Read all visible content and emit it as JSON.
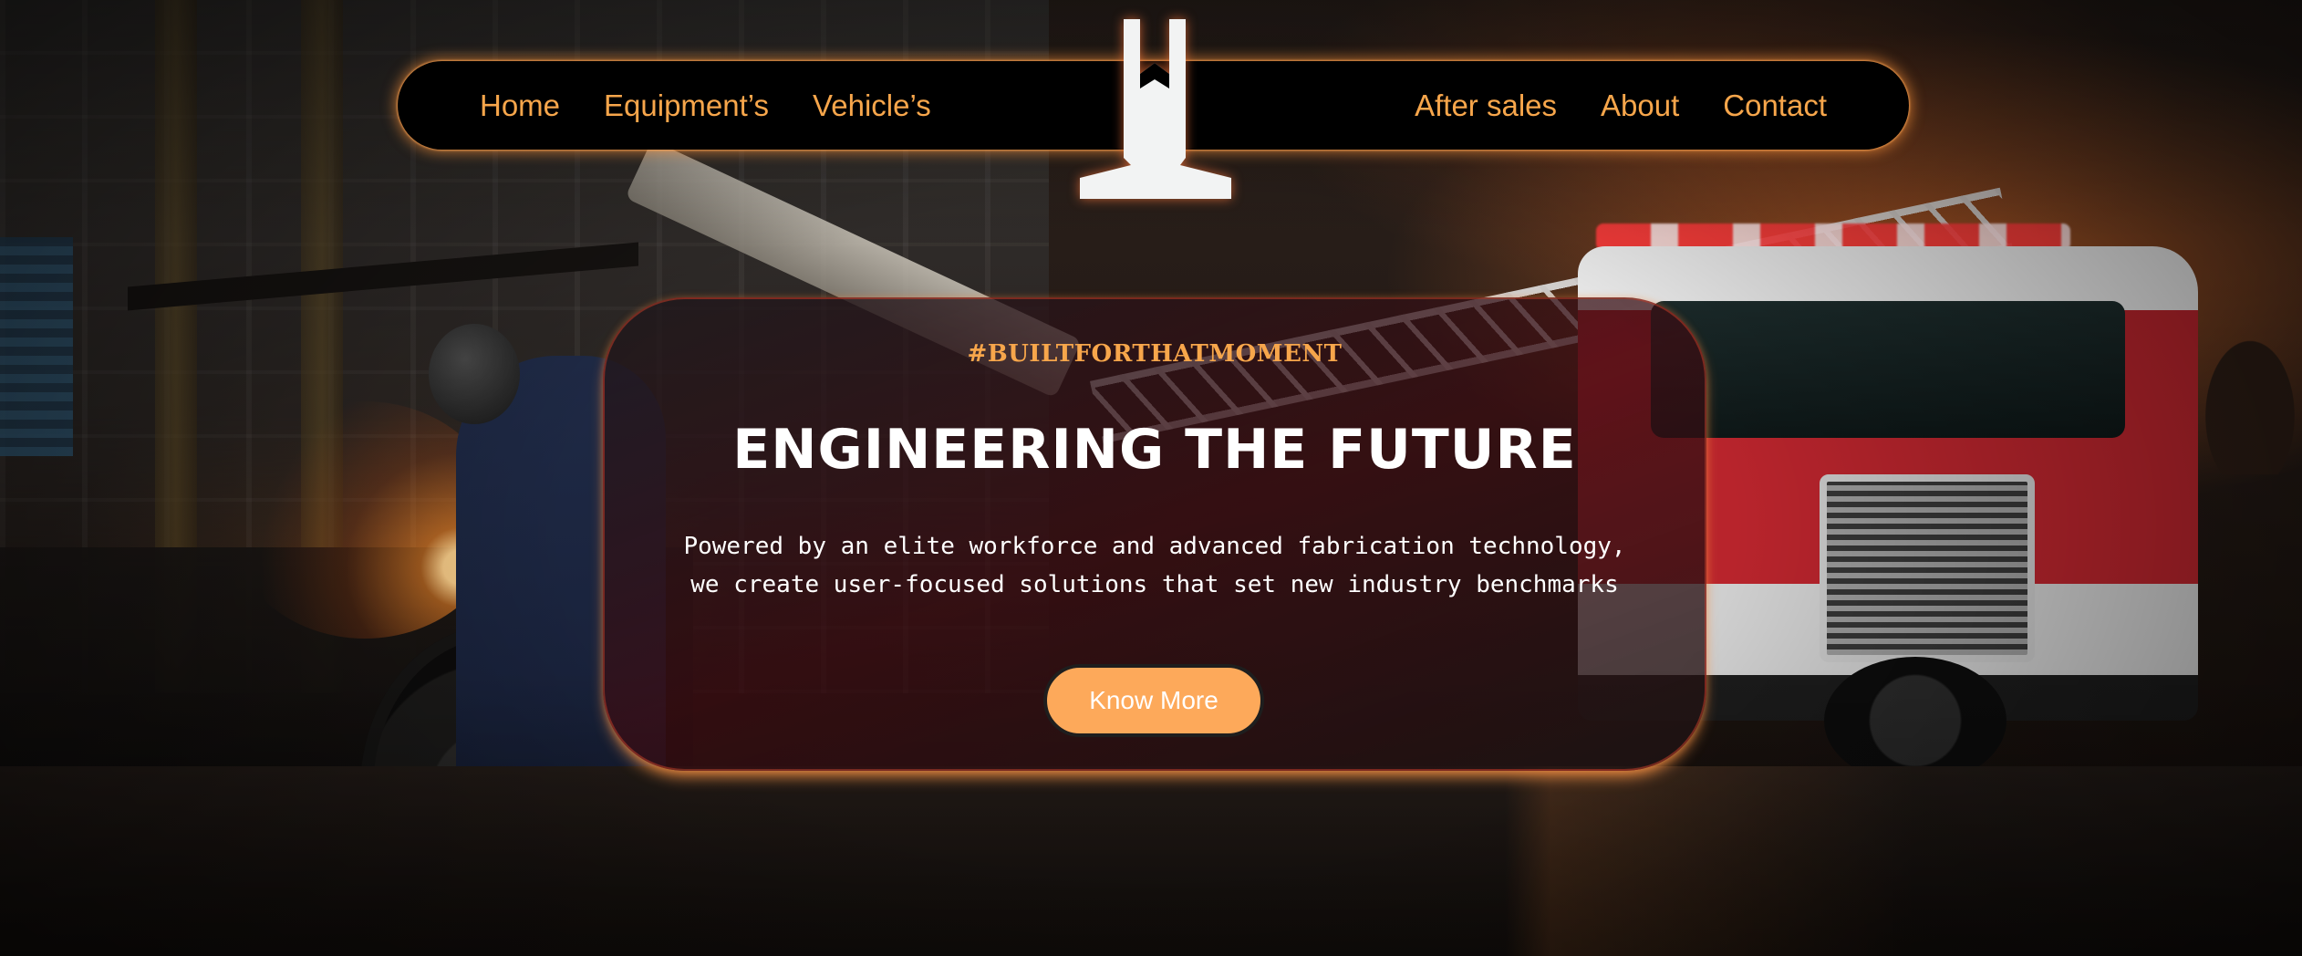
{
  "nav": {
    "left_items": [
      {
        "label": "Home"
      },
      {
        "label": "Equipment’s"
      },
      {
        "label": "Vehicle’s"
      }
    ],
    "right_items": [
      {
        "label": "After sales"
      },
      {
        "label": "About"
      },
      {
        "label": "Contact"
      }
    ]
  },
  "logo": {
    "icon": "brand-logo-icon"
  },
  "hero": {
    "hashtag": "#BUILTFORTHATMOMENT",
    "title": "ENGINEERING THE FUTURE",
    "description_lines": [
      "Powered by an elite workforce and advanced fabrication technology,",
      "we create user-focused solutions that set new industry benchmarks"
    ],
    "cta_label": "Know More"
  },
  "colors": {
    "accent": "#f7a64b",
    "button": "#fda95a",
    "nav_background": "#000000",
    "title_text": "#ffffff"
  }
}
